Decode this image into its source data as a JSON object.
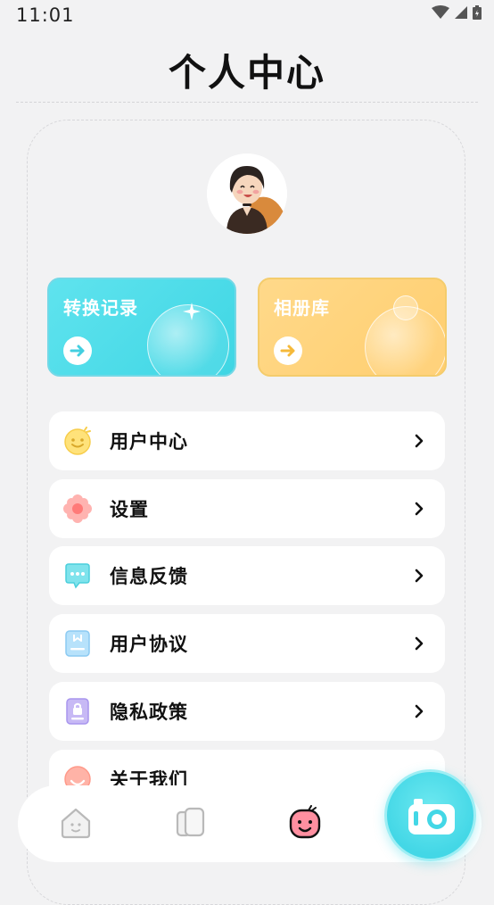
{
  "status_bar": {
    "time": "11:01"
  },
  "page": {
    "title": "个人中心"
  },
  "cards": [
    {
      "label": "转换记录",
      "color": "#4fdeea"
    },
    {
      "label": "相册库",
      "color": "#ffd37a"
    }
  ],
  "menu": [
    {
      "label": "用户中心",
      "icon": "smiley-icon"
    },
    {
      "label": "设置",
      "icon": "flower-gear-icon"
    },
    {
      "label": "信息反馈",
      "icon": "chat-bubble-icon"
    },
    {
      "label": "用户协议",
      "icon": "document-icon"
    },
    {
      "label": "隐私政策",
      "icon": "lock-document-icon"
    },
    {
      "label": "关于我们",
      "icon": "smiley-face-icon"
    }
  ],
  "tabbar": {
    "tabs": [
      {
        "name": "home-tab",
        "icon": "house-icon",
        "active": false
      },
      {
        "name": "album-tab",
        "icon": "cards-icon",
        "active": false
      },
      {
        "name": "profile-tab",
        "icon": "face-icon",
        "active": true
      }
    ],
    "fab_icon": "camera-icon"
  },
  "colors": {
    "accent": "#43d7e6",
    "background": "#f2f2f3"
  }
}
